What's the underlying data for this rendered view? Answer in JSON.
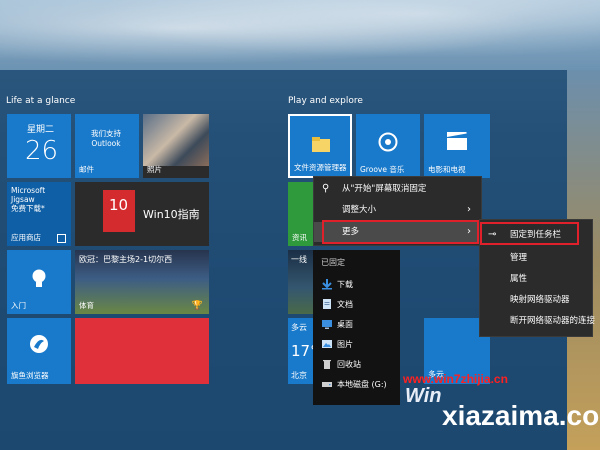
{
  "sections": {
    "left_title": "Life at a glance",
    "right_title": "Play and explore"
  },
  "tiles": {
    "calendar": {
      "day": "星期二",
      "date": "26"
    },
    "support": {
      "line1": "我们支持",
      "line2": "Outlook",
      "label": "邮件"
    },
    "photos": {
      "label": "照片"
    },
    "store": {
      "line1": "Microsoft",
      "line2": "Jigsaw",
      "line3": "免费下载*",
      "label": "应用商店"
    },
    "win10": {
      "badge": "10",
      "text": "Win10指南"
    },
    "sports": {
      "headline": "欧冠：巴黎主场2-1切尔西",
      "label": "体育"
    },
    "weather": {
      "label": "入门"
    },
    "browser": {
      "label": "旗鱼浏览器"
    },
    "file_explorer": {
      "label": "文件资源管理器"
    },
    "groove": {
      "label": "Groove 音乐"
    },
    "movies": {
      "label": "电影和电视"
    },
    "news_left": {
      "label": "资讯"
    },
    "lockscreen": {
      "label": "一线"
    },
    "weather2": {
      "label1": "多云",
      "temp": "17°",
      "city": "北京",
      "label2": "多云"
    }
  },
  "context_menu": {
    "items": [
      {
        "icon": "unpin-icon",
        "label": "从\"开始\"屏幕取消固定"
      },
      {
        "icon": "",
        "label": "调整大小",
        "arrow": "›"
      },
      {
        "icon": "",
        "label": "更多",
        "arrow": "›"
      }
    ]
  },
  "submenu": {
    "items": [
      {
        "icon": "pin-icon",
        "label": "固定到任务栏"
      },
      {
        "label": "管理"
      },
      {
        "label": "属性"
      },
      {
        "label": "映射网络驱动器"
      },
      {
        "label": "断开网络驱动器的连接"
      }
    ]
  },
  "jumplist": {
    "header": "已固定",
    "items": [
      {
        "icon": "download-icon",
        "label": "下载",
        "color": "#3a8fe0"
      },
      {
        "icon": "document-icon",
        "label": "文档",
        "color": "#cfe3f7"
      },
      {
        "icon": "desktop-icon",
        "label": "桌面",
        "color": "#3a8fe0"
      },
      {
        "icon": "picture-icon",
        "label": "图片",
        "color": "#cfe3f7"
      },
      {
        "icon": "recycle-bin-icon",
        "label": "回收站",
        "color": "#cfcfcf"
      },
      {
        "icon": "disk-icon",
        "label": "本地磁盘 (G:)",
        "color": "#cfcfcf"
      }
    ]
  },
  "watermark": {
    "url": "www.win7zhijia.cn",
    "site": "xiazaima.com",
    "logo": "Win"
  }
}
